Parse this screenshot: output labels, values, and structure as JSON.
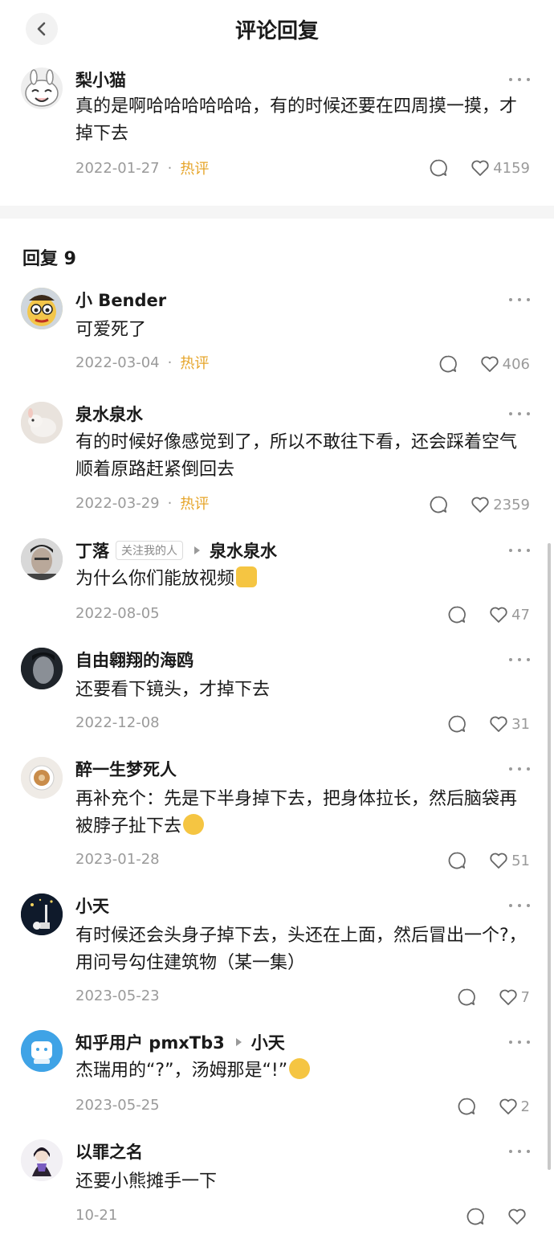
{
  "header": {
    "title": "评论回复"
  },
  "main_comment": {
    "name": "梨小猫",
    "text": "真的是啊哈哈哈哈哈哈，有的时候还要在四周摸一摸，才掉下去",
    "date": "2022-01-27",
    "hot": "热评",
    "likes": "4159"
  },
  "replies_header": "回复 9",
  "replies": [
    {
      "name": "小 Bender",
      "text": "可爱死了",
      "date": "2022-03-04",
      "hot": "热评",
      "likes": "406"
    },
    {
      "name": "泉水泉水",
      "text": "有的时候好像感觉到了，所以不敢往下看，还会踩着空气顺着原路赶紧倒回去",
      "date": "2022-03-29",
      "hot": "热评",
      "likes": "2359"
    },
    {
      "name": "丁落",
      "tag": "关注我的人",
      "reply_to": "泉水泉水",
      "text": "为什么你们能放视频",
      "date": "2022-08-05",
      "likes": "47"
    },
    {
      "name": "自由翱翔的海鸥",
      "text": "还要看下镜头，才掉下去",
      "date": "2022-12-08",
      "likes": "31"
    },
    {
      "name": "醉一生梦死人",
      "text": "再补充个：先是下半身掉下去，把身体拉长，然后脑袋再被脖子扯下去",
      "date": "2023-01-28",
      "likes": "51"
    },
    {
      "name": "小天",
      "text": "有时候还会头身子掉下去，头还在上面，然后冒出一个?，用问号勾住建筑物（某一集）",
      "date": "2023-05-23",
      "likes": "7"
    },
    {
      "name": "知乎用户 pmxTb3",
      "reply_to": "小天",
      "text": "杰瑞用的“?”，汤姆那是“!”",
      "date": "2023-05-25",
      "likes": "2"
    },
    {
      "name": "以罪之名",
      "text": "还要小熊摊手一下",
      "date": "10-21",
      "likes": ""
    }
  ],
  "colors": {
    "hot": "#e6a52a",
    "meta": "#9a9a9a",
    "divider": "#f5f5f5"
  },
  "icons": [
    "back-chevron-icon",
    "more-dots-icon",
    "comment-bubble-icon",
    "heart-icon",
    "emoji-icon"
  ]
}
